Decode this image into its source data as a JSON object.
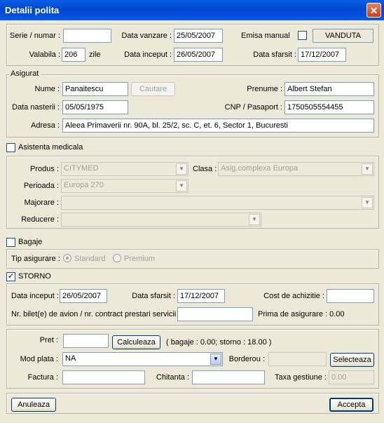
{
  "window": {
    "title": "Detalii polita",
    "close_glyph": "✕"
  },
  "policy": {
    "serie_label": "Serie / numar :",
    "serie_value": "",
    "data_vanzare_label": "Data vanzare :",
    "data_vanzare_value": "25/05/2007",
    "emisa_label": "Emisa manual",
    "status_badge": "VANDUTA",
    "valabila_label": "Valabila :",
    "valabila_value": "206",
    "zile_label": "zile",
    "data_inceput_label": "Data inceput :",
    "data_inceput_value": "26/05/2007",
    "data_sfarsit_label": "Data sfarsit :",
    "data_sfarsit_value": "17/12/2007"
  },
  "insured": {
    "group_label": "Asigurat",
    "nume_label": "Nume :",
    "nume_value": "Panaitescu",
    "cautare_label": "Cautare",
    "prenume_label": "Prenume :",
    "prenume_value": "Albert Stefan",
    "data_nasterii_label": "Data nasterii :",
    "data_nasterii_value": "05/05/1975",
    "cnp_label": "CNP / Pasaport :",
    "cnp_value": "1750505554455",
    "adresa_label": "Adresa :",
    "adresa_value": "Aleea Primaverii nr. 90A, bl. 25/2, sc. C, et. 6, Sector 1, Bucuresti"
  },
  "medical": {
    "checkbox_label": "Asistenta medicala",
    "produs_label": "Produs :",
    "produs_value": "CITYMED",
    "clasa_label": "Clasa :",
    "clasa_value": "Asig.complexa Europa",
    "perioada_label": "Perioada :",
    "perioada_value": "Europa 270",
    "majorare_label": "Majorare :",
    "majorare_value": "",
    "reducere_label": "Reducere :",
    "reducere_value": ""
  },
  "baggage": {
    "checkbox_label": "Bagaje",
    "tip_label": "Tip  asigurare :",
    "standard_label": "Standard",
    "premium_label": "Premium"
  },
  "storno": {
    "checkbox_label": "STORNO",
    "checked_glyph": "✓",
    "data_inceput_label": "Data inceput :",
    "data_inceput_value": "26/05/2007",
    "data_sfarsit_label": "Data sfarsit :",
    "data_sfarsit_value": "17/12/2007",
    "cost_label": "Cost de achizitie :",
    "cost_value": "",
    "bilet_label": "Nr. bilet(e) de avion / nr. contract prestari servicii :",
    "bilet_value": "",
    "prima_label": "Prima de asigurare : 0.00"
  },
  "payment": {
    "pret_label": "Pret :",
    "pret_value": "",
    "calculeaza_label": "Calculeaza",
    "summary": "( bagaje : 0.00; storno : 18.00 )",
    "mod_plata_label": "Mod plata :",
    "mod_plata_value": "NA",
    "borderou_label": "Borderou :",
    "borderou_value": "",
    "selecteaza_label": "Selecteaza",
    "factura_label": "Factura :",
    "factura_value": "",
    "chitanta_label": "Chitanta :",
    "chitanta_value": "",
    "taxa_label": "Taxa gestiune :",
    "taxa_value": "0.00"
  },
  "footer": {
    "anuleaza_label": "Anuleaza",
    "accepta_label": "Accepta"
  },
  "icons": {
    "dropdown": "▼"
  },
  "colors": {
    "titlebar": "#0047d1",
    "window_bg": "#ece9d8",
    "close": "#c93c1a"
  }
}
